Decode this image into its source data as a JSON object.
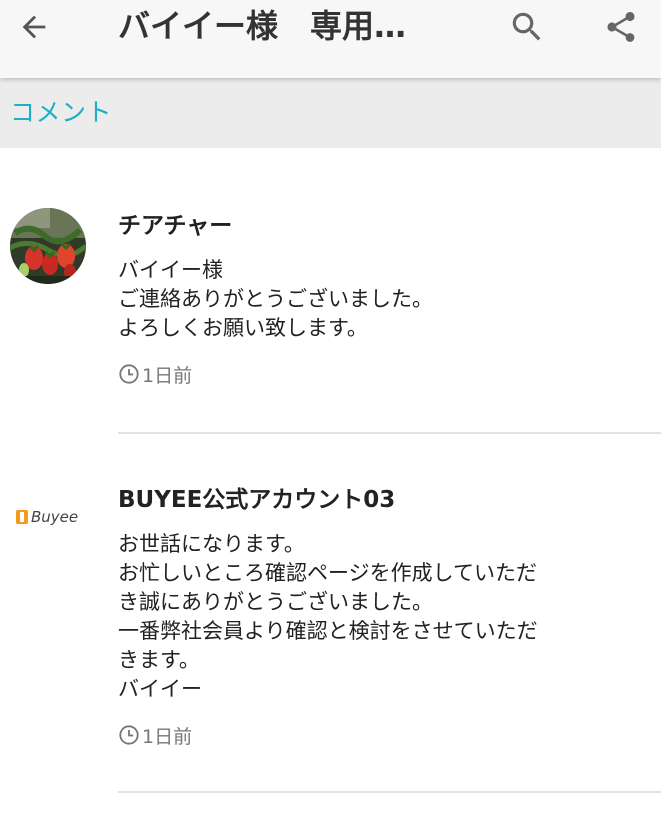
{
  "header": {
    "title": "バイイー様　専用…"
  },
  "section": {
    "label": "コメント"
  },
  "comments": [
    {
      "author": "チアチャー",
      "lines": [
        "バイイー様",
        "ご連絡ありがとうございました。",
        "よろしくお願い致します。"
      ],
      "time": "1日前"
    },
    {
      "author": "BUYEE公式アカウント03",
      "logo_text": "Buyee",
      "lines": [
        "お世話になります。",
        "お忙しいところ確認ページを作成していただ",
        "き誠にありがとうございました。",
        "一番弊社会員より確認と検討をさせていただ",
        "きます。",
        "バイイー"
      ],
      "time": "1日前"
    }
  ],
  "colors": {
    "accent": "#1cb0c5",
    "buyee_orange": "#f39a1c"
  }
}
